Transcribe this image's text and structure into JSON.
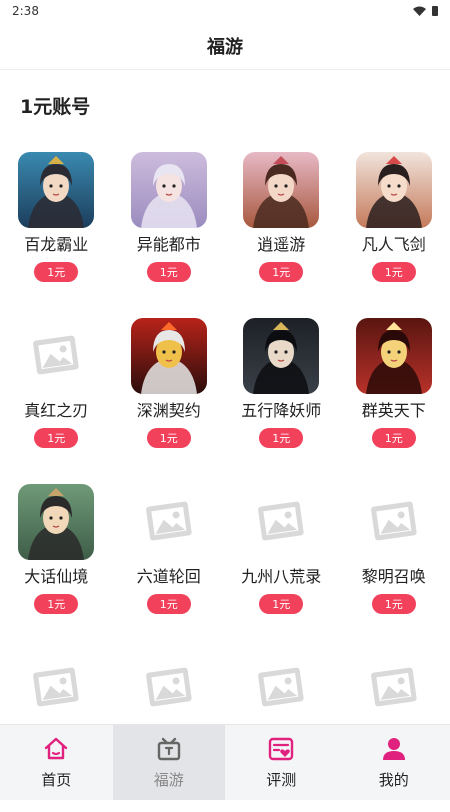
{
  "status_bar": {
    "time": "2:38",
    "icons": [
      "wifi-icon",
      "battery-icon"
    ]
  },
  "header": {
    "title": "福游"
  },
  "section": {
    "title": "1元账号"
  },
  "colors": {
    "accent": "#f2415b",
    "nav_accent": "#e0217d",
    "placeholder": "#d9d9d9"
  },
  "games": [
    {
      "name": "百龙霸业",
      "price": "1元",
      "icon": "game-art-icon"
    },
    {
      "name": "异能都市",
      "price": "1元",
      "icon": "game-art-icon"
    },
    {
      "name": "逍遥游",
      "price": "1元",
      "icon": "game-art-icon"
    },
    {
      "name": "凡人飞剑",
      "price": "1元",
      "icon": "game-art-icon"
    },
    {
      "name": "真红之刃",
      "price": "1元",
      "icon": "image-placeholder-icon"
    },
    {
      "name": "深渊契约",
      "price": "1元",
      "icon": "game-art-icon"
    },
    {
      "name": "五行降妖师",
      "price": "1元",
      "icon": "game-art-icon"
    },
    {
      "name": "群英天下",
      "price": "1元",
      "icon": "game-art-icon"
    },
    {
      "name": "大话仙境",
      "price": "1元",
      "icon": "game-art-icon"
    },
    {
      "name": "六道轮回",
      "price": "1元",
      "icon": "image-placeholder-icon"
    },
    {
      "name": "九州八荒录",
      "price": "1元",
      "icon": "image-placeholder-icon"
    },
    {
      "name": "黎明召唤",
      "price": "1元",
      "icon": "image-placeholder-icon"
    },
    {
      "name": "",
      "price": "",
      "icon": "image-placeholder-icon"
    },
    {
      "name": "",
      "price": "",
      "icon": "image-placeholder-icon"
    },
    {
      "name": "",
      "price": "",
      "icon": "image-placeholder-icon"
    },
    {
      "name": "",
      "price": "",
      "icon": "image-placeholder-icon"
    }
  ],
  "nav": [
    {
      "label": "首页",
      "icon": "home-icon",
      "active": false
    },
    {
      "label": "福游",
      "icon": "gift-box-icon",
      "active": true
    },
    {
      "label": "评测",
      "icon": "review-heart-icon",
      "active": false
    },
    {
      "label": "我的",
      "icon": "user-icon",
      "active": false
    }
  ]
}
